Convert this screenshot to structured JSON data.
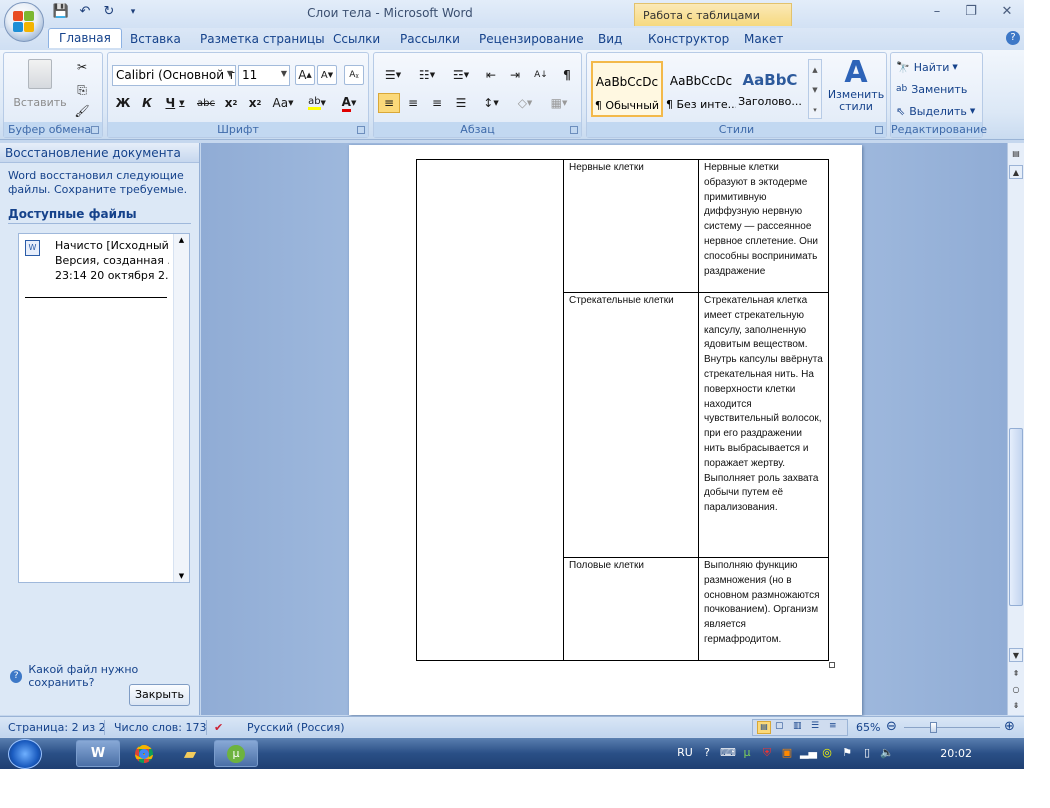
{
  "window": {
    "title": "Слои тела - Microsoft Word",
    "contextual_tab_group": "Работа с таблицами"
  },
  "tabs": [
    {
      "label": "Главная",
      "active": true
    },
    {
      "label": "Вставка"
    },
    {
      "label": "Разметка страницы"
    },
    {
      "label": "Ссылки"
    },
    {
      "label": "Рассылки"
    },
    {
      "label": "Рецензирование"
    },
    {
      "label": "Вид"
    },
    {
      "label": "Конструктор"
    },
    {
      "label": "Макет"
    }
  ],
  "ribbon": {
    "clipboard": {
      "paste_label": "Вставить",
      "group_label": "Буфер обмена"
    },
    "font": {
      "font_name": "Calibri (Основной те",
      "font_size": "11",
      "group_label": "Шрифт"
    },
    "paragraph": {
      "group_label": "Абзац"
    },
    "styles": {
      "group_label": "Стили",
      "items": [
        {
          "sample": "AaBbCcDc",
          "name": "¶ Обычный"
        },
        {
          "sample": "AaBbCcDc",
          "name": "¶ Без инте..."
        },
        {
          "sample": "AaBbC",
          "name": "Заголово..."
        }
      ],
      "change_styles_label": "Изменить стили"
    },
    "editing": {
      "group_label": "Редактирование",
      "find_label": "Найти",
      "replace_label": "Заменить",
      "select_label": "Выделить"
    }
  },
  "recovery_pane": {
    "title": "Восстановление документа",
    "description": "Word восстановил следующие файлы.  Сохраните требуемые.",
    "available_files_label": "Доступные файлы",
    "file": {
      "line1": "Начисто  [Исходный]",
      "line2": "Версия, созданная ...",
      "line3": "23:14 20 октября 2..."
    },
    "question_link": "Какой файл нужно сохранить?",
    "close_label": "Закрыть"
  },
  "document": {
    "rows": [
      {
        "name": "Нервные клетки",
        "desc": "Нервные клетки образуют в эктодерме примитивную диффузную нервную систему — рассеянное нервное сплетение. Они способны воспринимать раздражение"
      },
      {
        "name": "Стрекательные клетки",
        "desc": "Стрекательная клетка имеет стрекательную капсулу, заполненную ядовитым веществом. Внутрь капсулы ввёрнута стрекательная нить. На поверхности клетки находится чувствительный волосок, при его раздражении нить выбрасывается и поражает жертву. Выполняет роль захвата добычи путем её парализования."
      },
      {
        "name": "Половые клетки",
        "desc": "Выполняю функцию размножения (но в основном размножаются почкованием). Организм является гермафродитом."
      }
    ]
  },
  "statusbar": {
    "page": "Страница: 2 из 2",
    "words": "Число слов: 173",
    "language": "Русский (Россия)",
    "zoom": "65%",
    "zoom_level": 0.65
  },
  "taskbar": {
    "lang": "RU",
    "time": "20:02"
  }
}
